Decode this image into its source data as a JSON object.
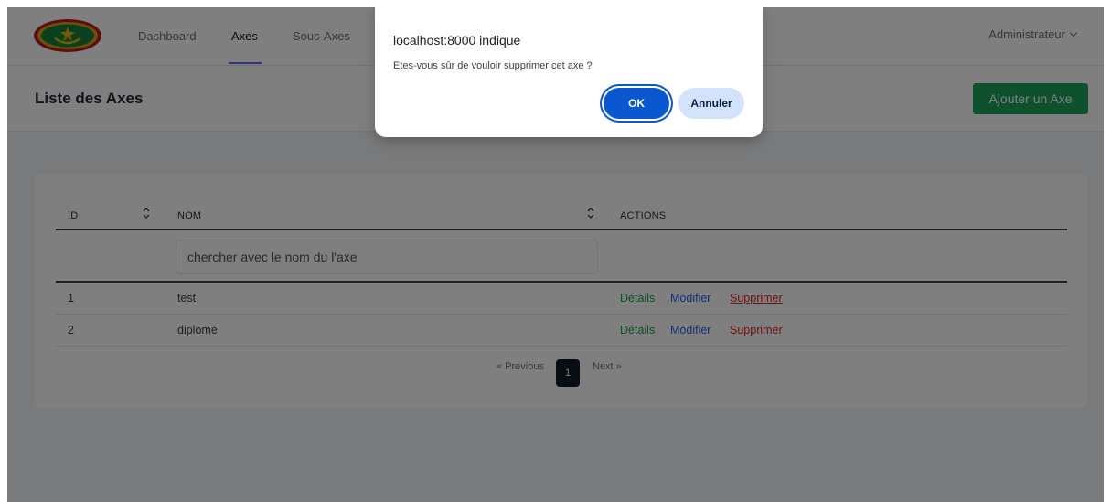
{
  "nav": {
    "links": [
      "Dashboard",
      "Axes",
      "Sous-Axes"
    ],
    "active": "Axes",
    "user": "Administrateur"
  },
  "header": {
    "title": "Liste des Axes",
    "add_button": "Ajouter un Axe"
  },
  "table": {
    "columns": [
      "ID",
      "NOM",
      "ACTIONS"
    ],
    "search_placeholder": "chercher avec le nom du l'axe",
    "rows": [
      {
        "id": "1",
        "nom": "test",
        "details": "Détails",
        "modifier": "Modifier",
        "supprimer": "Supprimer"
      },
      {
        "id": "2",
        "nom": "diplome",
        "details": "Détails",
        "modifier": "Modifier",
        "supprimer": "Supprimer"
      }
    ],
    "pagination": {
      "previous": "« Previous",
      "current": "1",
      "next": "Next »"
    }
  },
  "dialog": {
    "title": "localhost:8000 indique",
    "message": "Etes-vous sûr de vouloir supprimer cet axe ?",
    "ok": "OK",
    "cancel": "Annuler"
  },
  "colors": {
    "primary_green": "#1aa35a",
    "details": "#16a34a",
    "modify": "#2563eb",
    "delete": "#dc2626",
    "dialog_ok": "#0b57d0",
    "dialog_cancel": "#d3e3fd"
  }
}
